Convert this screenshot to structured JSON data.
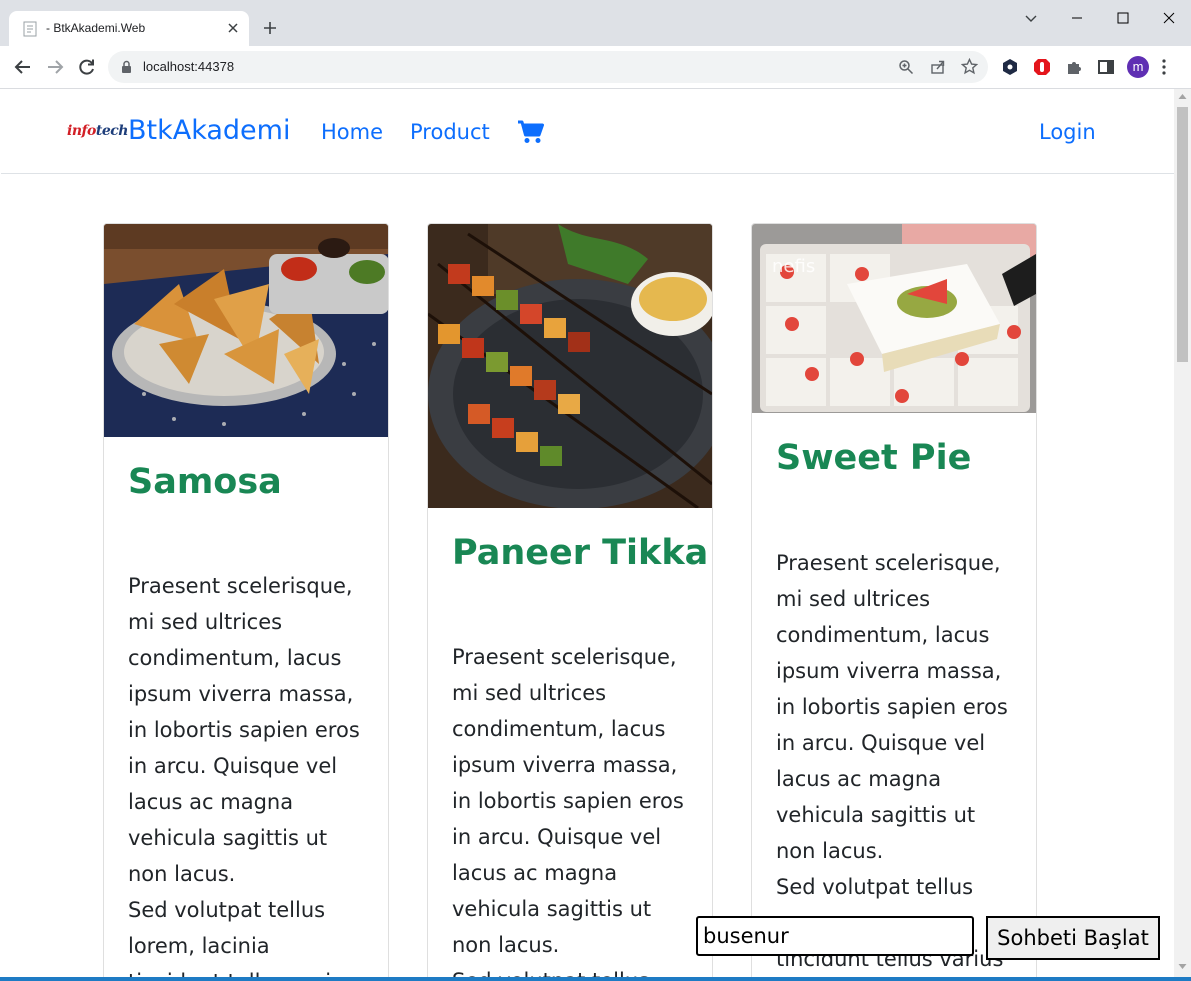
{
  "browser": {
    "tab_title": "- BtkAkademi.Web",
    "url": "localhost:44378",
    "profile_initial": "m"
  },
  "navbar": {
    "logo_text_red": "info",
    "logo_text_navy": "tech",
    "brand": "BtkAkademi",
    "links": [
      "Home",
      "Product"
    ],
    "login": "Login",
    "link_color": "#0d6efd"
  },
  "products": [
    {
      "title": "Samosa",
      "lines": [
        "Praesent scelerisque,",
        "mi sed ultrices",
        "condimentum, lacus",
        "ipsum viverra massa,",
        "in lobortis sapien eros",
        "in arcu. Quisque vel",
        "lacus ac magna",
        "vehicula sagittis ut",
        "non lacus.",
        "Sed volutpat tellus",
        "lorem, lacinia",
        "tincidunt tellus varius"
      ]
    },
    {
      "title": "Paneer Tikka",
      "lines": [
        "Praesent scelerisque,",
        "mi sed ultrices",
        "condimentum, lacus",
        "ipsum viverra massa,",
        "in lobortis sapien eros",
        "in arcu. Quisque vel",
        "lacus ac magna",
        "vehicula sagittis ut",
        "non lacus.",
        "Sed volutpat tellus"
      ]
    },
    {
      "title": "Sweet Pie",
      "image_watermark": "nefis",
      "lines": [
        "Praesent scelerisque,",
        "mi sed ultrices",
        "condimentum, lacus",
        "ipsum viverra massa,",
        "in lobortis sapien eros",
        "in arcu. Quisque vel",
        "lacus ac magna",
        "vehicula sagittis ut",
        "non lacus.",
        "Sed volutpat tellus",
        "",
        "tincidunt tellus varius"
      ]
    }
  ],
  "chat": {
    "username_value": "busenur",
    "start_button": "Sohbeti Başlat"
  },
  "colors": {
    "title_green": "#198754",
    "text": "#212529"
  }
}
